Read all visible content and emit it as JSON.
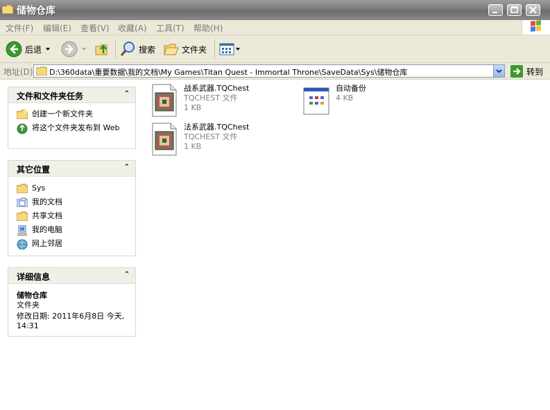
{
  "window": {
    "title": "储物仓库"
  },
  "menu": {
    "file": "文件(F)",
    "edit": "编辑(E)",
    "view": "查看(V)",
    "favorites": "收藏(A)",
    "tools": "工具(T)",
    "help": "帮助(H)"
  },
  "toolbar": {
    "back": "后退",
    "search": "搜索",
    "folders": "文件夹"
  },
  "address": {
    "label": "地址(D)",
    "path": "D:\\360data\\重要数据\\我的文档\\My Games\\Titan Quest - Immortal Throne\\SaveData\\Sys\\储物仓库",
    "go": "转到"
  },
  "tasks_panel": {
    "title": "文件和文件夹任务",
    "items": [
      {
        "label": "创建一个新文件夹",
        "icon": "new-folder-icon"
      },
      {
        "label": "将这个文件夹发布到 Web",
        "icon": "publish-web-icon"
      }
    ]
  },
  "places_panel": {
    "title": "其它位置",
    "items": [
      {
        "label": "Sys",
        "icon": "folder-icon"
      },
      {
        "label": "我的文档",
        "icon": "my-documents-icon"
      },
      {
        "label": "共享文档",
        "icon": "shared-folder-icon"
      },
      {
        "label": "我的电脑",
        "icon": "my-computer-icon"
      },
      {
        "label": "网上邻居",
        "icon": "network-icon"
      }
    ]
  },
  "details_panel": {
    "title": "详细信息",
    "name": "储物仓库",
    "type": "文件夹",
    "modified": "修改日期: 2011年6月8日 今天, 14:31"
  },
  "files": [
    {
      "name": "战系武器.TQChest",
      "type": "TQCHEST 文件",
      "size": "1 KB",
      "icon": "tqchest-file-icon"
    },
    {
      "name": "自动备份",
      "type": "",
      "size": "4 KB",
      "icon": "generic-file-icon"
    },
    {
      "name": "法系武器.TQChest",
      "type": "TQCHEST 文件",
      "size": "1 KB",
      "icon": "tqchest-file-icon"
    }
  ]
}
